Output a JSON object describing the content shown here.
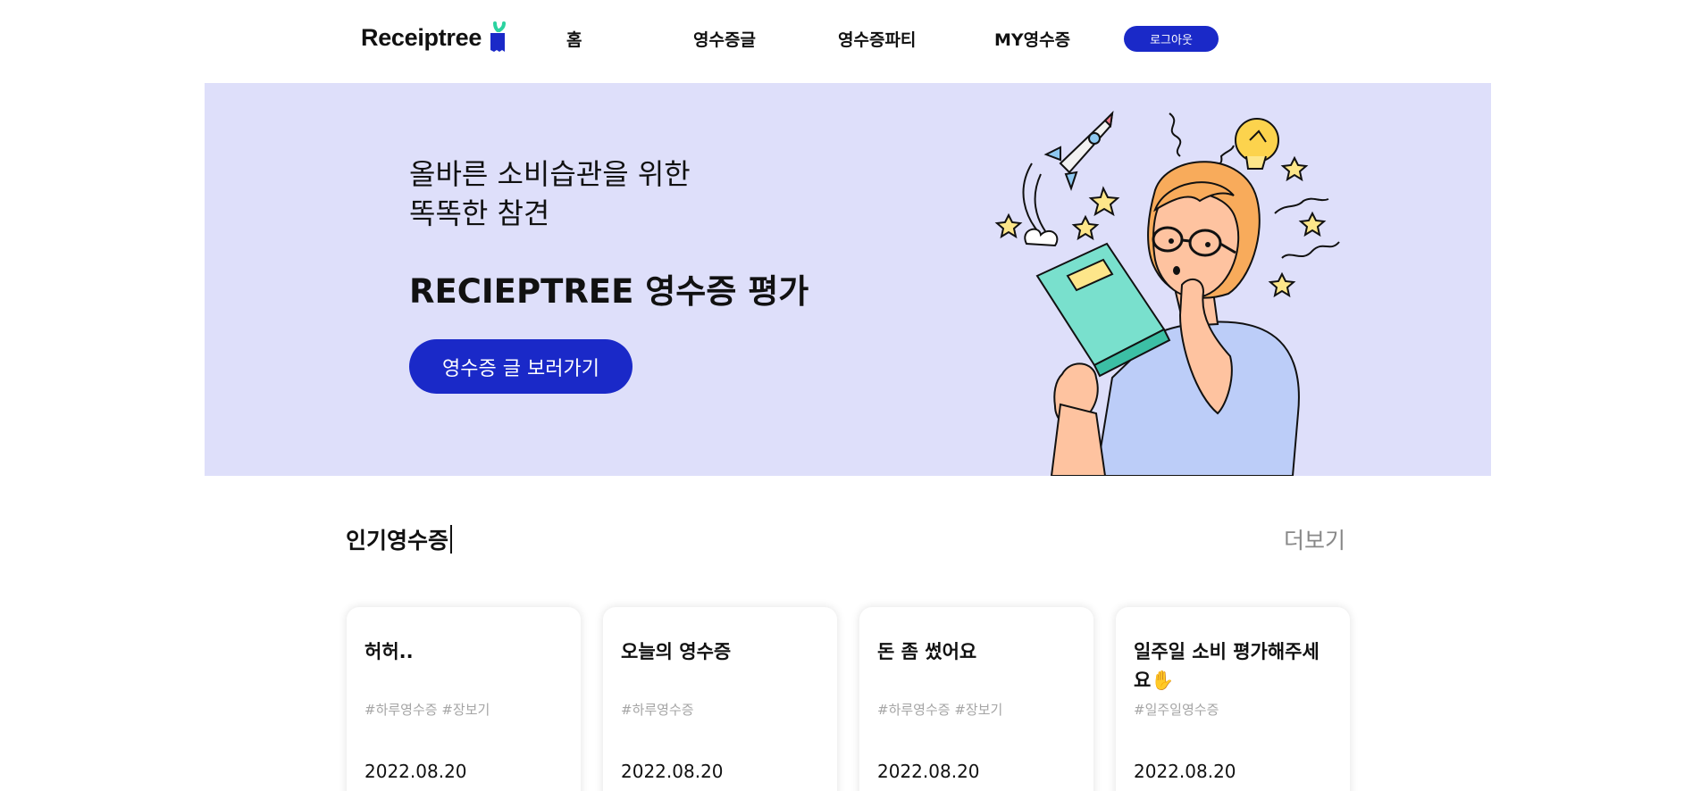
{
  "nav": {
    "logo_text": "Receiptree",
    "items": [
      {
        "label": "홈"
      },
      {
        "label": "영수증글"
      },
      {
        "label": "영수증파티"
      },
      {
        "label": "MY영수증"
      }
    ],
    "logout_label": "로그아웃"
  },
  "hero": {
    "subtitle_line1": "올바른 소비습관을 위한",
    "subtitle_line2": "똑똑한 참견",
    "title": "RECIEPTREE 영수증 평가",
    "button_label": "영수증 글 보러가기"
  },
  "popular": {
    "title": "인기영수증",
    "more_label": "더보기",
    "cards": [
      {
        "title": "허허..",
        "tags": "#하루영수증 #장보기",
        "date": "2022.08.20"
      },
      {
        "title": "오늘의 영수증",
        "tags": "#하루영수증",
        "date": "2022.08.20"
      },
      {
        "title": "돈 좀 썼어요",
        "tags": "#하루영수증 #장보기",
        "date": "2022.08.20"
      },
      {
        "title": "일주일 소비 평가해주세요✋",
        "tags": "#일주일영수증",
        "date": "2022.08.20"
      }
    ]
  },
  "colors": {
    "accent": "#1a29c8",
    "hero_bg": "#dedffa",
    "logo_green": "#2bd3a0",
    "tag_gray": "#a5a5a5"
  },
  "icons": [
    "receipt-logo-icon",
    "hero-illustration"
  ]
}
